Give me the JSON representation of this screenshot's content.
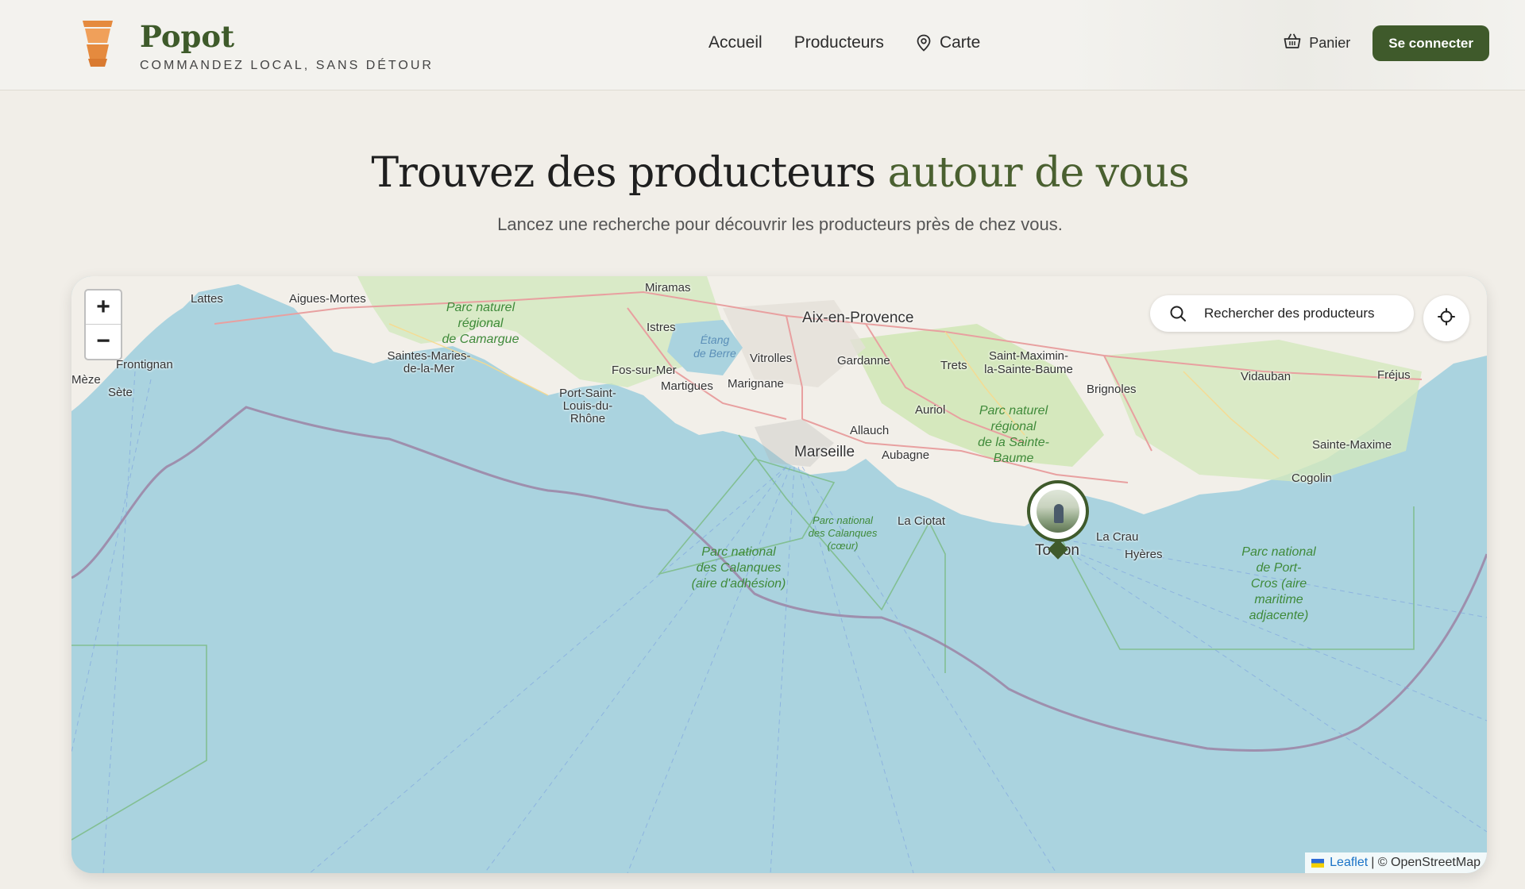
{
  "header": {
    "brand_name": "Popot",
    "brand_tagline": "COMMANDEZ LOCAL, SANS DÉTOUR",
    "nav": [
      {
        "label": "Accueil"
      },
      {
        "label": "Producteurs"
      },
      {
        "label": "Carte",
        "icon": "map-pin-icon"
      }
    ],
    "cart_label": "Panier",
    "login_label": "Se connecter"
  },
  "hero": {
    "title_main": "Trouvez des producteurs ",
    "title_accent": "autour de vous",
    "subtitle": "Lancez une recherche pour découvrir les producteurs près de chez vous."
  },
  "map": {
    "zoom_in": "+",
    "zoom_out": "−",
    "search_label": "Rechercher des producteurs",
    "attribution_link": "Leaflet",
    "attribution_text": "| © OpenStreetMap",
    "labels": {
      "aix": "Aix-en-Provence",
      "marseille": "Marseille",
      "toulon": "Toulon",
      "miramas": "Miramas",
      "istres": "Istres",
      "lattes": "Lattes",
      "aigues": "Aigues-Mortes",
      "frontignan": "Frontignan",
      "meze": "Mèze",
      "sete": "Sète",
      "saintes": "Saintes-Maries-\nde-la-Mer",
      "portsaint": "Port-Saint-\nLouis-du-Rhône",
      "fos": "Fos-sur-Mer",
      "martigues": "Martigues",
      "marignane": "Marignane",
      "vitrolles": "Vitrolles",
      "gardanne": "Gardanne",
      "trets": "Trets",
      "stmax": "Saint-Maximin-\nla-Sainte-Baume",
      "brignoles": "Brignoles",
      "vidauban": "Vidauban",
      "frejus": "Fréjus",
      "auriol": "Auriol",
      "allauch": "Allauch",
      "aubagne": "Aubagne",
      "laciotat": "La Ciotat",
      "lacrau": "La Crau",
      "hyeres": "Hyères",
      "stemaxime": "Sainte-Maxime",
      "cogolin": "Cogolin",
      "camargue": "Parc naturel\nrégional\nde Camargue",
      "saintebaume": "Parc naturel\nrégional\nde la Sainte-\nBaume",
      "calanques_coeur": "Parc national\ndes Calanques\n(cœur)",
      "calanques_adh": "Parc national\ndes Calanques\n(aire d'adhésion)",
      "portcros": "Parc national\nde Port-\nCros (aire\nmaritime\nadjacente)",
      "etang": "Étang\nde Berre"
    }
  }
}
